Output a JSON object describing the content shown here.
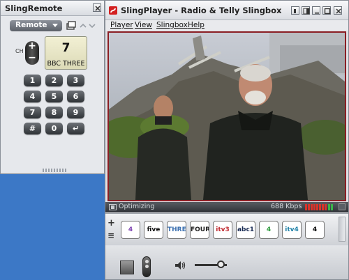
{
  "remote_window": {
    "title": "SlingRemote",
    "dropdown_label": "Remote",
    "ch_label": "CH",
    "rocker_plus": "+",
    "rocker_minus": "−",
    "lcd_channel_number": "7",
    "lcd_channel_name": "BBC THREE",
    "keys": [
      "1",
      "2",
      "3",
      "4",
      "5",
      "6",
      "7",
      "8",
      "9",
      "#",
      "0",
      "↵"
    ]
  },
  "player_window": {
    "title": "SlingPlayer - Radio & Telly Slingbox",
    "menu": [
      "Player",
      "View",
      "Slingbox",
      "Help"
    ],
    "status_text": "Optimizing",
    "bitrate": "688 Kbps",
    "channels": [
      {
        "id": "channel-4",
        "label": "4",
        "color": "#7b3fb0"
      },
      {
        "id": "channel-five",
        "label": "five",
        "color": "#111111"
      },
      {
        "id": "channel-three",
        "label": "THREE",
        "color": "#3a6fb0"
      },
      {
        "id": "channel-bbc-four",
        "label": "FOUR",
        "color": "#222222"
      },
      {
        "id": "channel-itv3",
        "label": "itv3",
        "color": "#c0282e"
      },
      {
        "id": "channel-abc1",
        "label": "abc1",
        "color": "#1a2c55"
      },
      {
        "id": "channel-more4",
        "label": "4",
        "color": "#2a9a3a"
      },
      {
        "id": "channel-itv4",
        "label": "itv4",
        "color": "#1b7fa6"
      },
      {
        "id": "channel-4-black",
        "label": "4",
        "color": "#000000"
      }
    ]
  },
  "colors": {
    "desktop": "#3c78c6",
    "video_border": "#8b1e24",
    "signal_red": "#d9342b",
    "signal_green": "#3bb54a"
  },
  "icons": [
    "close-icon",
    "remote-view-icon",
    "up-arrow-icon",
    "down-arrow-icon",
    "app-logo-icon",
    "minimize-icon",
    "maximize-icon",
    "restore-icon",
    "film-icon",
    "signal-meter-icon",
    "speaker-icon",
    "volume-slider"
  ]
}
